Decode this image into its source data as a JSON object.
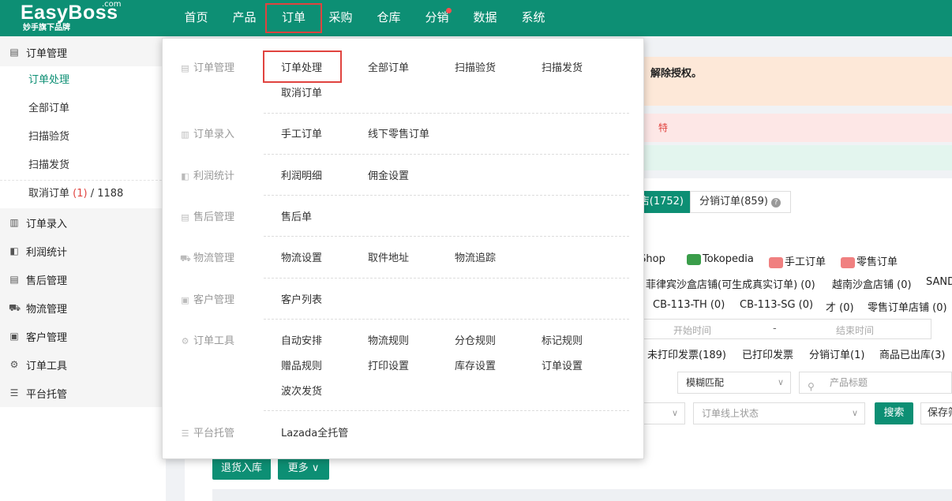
{
  "header": {
    "logo": "EasyBoss",
    "logo_com": ".com",
    "logo_sub": "妙手旗下品牌",
    "nav": [
      "首页",
      "产品",
      "订单",
      "采购",
      "仓库",
      "分销",
      "数据",
      "系统"
    ]
  },
  "sidebar": {
    "groups": [
      {
        "label": "订单管理",
        "icon": "order-doc-icon"
      },
      {
        "label": "订单录入",
        "icon": "order-entry-icon"
      },
      {
        "label": "利润统计",
        "icon": "profit-icon"
      },
      {
        "label": "售后管理",
        "icon": "aftersale-icon"
      },
      {
        "label": "物流管理",
        "icon": "truck-icon"
      },
      {
        "label": "客户管理",
        "icon": "customer-icon"
      },
      {
        "label": "订单工具",
        "icon": "tools-icon"
      },
      {
        "label": "平台托管",
        "icon": "hosting-icon"
      }
    ],
    "subitems": [
      "订单处理",
      "全部订单",
      "扫描验货",
      "扫描发货",
      "取消订单"
    ],
    "cancel_count": "(1)",
    "cancel_total": "/ 1188"
  },
  "main": {
    "alert1_text": "解除授权。",
    "alert2_text": "特",
    "tab_selected": "店(1752)",
    "tab_distribution": "分销订单(859)",
    "help_icon": "?",
    "platforms": [
      "&Shop",
      "Tokopedia",
      "手工订单",
      "零售订单"
    ],
    "shops_row1": [
      "菲律宾沙盒店铺(可生成真实订单) (0)",
      "越南沙盒店铺 (0)",
      "SAND"
    ],
    "shops_row2": [
      "CB-113-TH (0)",
      "CB-113-SG (0)",
      "才 (0)",
      "零售订单店铺 (0)"
    ],
    "date_start": "开始时间",
    "date_sep": "-",
    "date_end": "结束时间",
    "status_filters": [
      "未打印发票(189)",
      "已打印发票",
      "分销订单(1)",
      "商品已出库(3)"
    ],
    "match_select": "模糊匹配",
    "product_title_placeholder": "产品标题",
    "online_status_placeholder": "订单线上状态",
    "search_button": "搜索",
    "save_button": "保存筛",
    "return_button": "退货入库",
    "more_button": "更多"
  },
  "dropdown": {
    "rows": [
      {
        "category": "订单管理",
        "links": [
          "订单处理",
          "全部订单",
          "扫描验货",
          "扫描发货",
          "取消订单"
        ]
      },
      {
        "category": "订单录入",
        "links": [
          "手工订单",
          "线下零售订单"
        ]
      },
      {
        "category": "利润统计",
        "links": [
          "利润明细",
          "佣金设置"
        ]
      },
      {
        "category": "售后管理",
        "links": [
          "售后单"
        ]
      },
      {
        "category": "物流管理",
        "links": [
          "物流设置",
          "取件地址",
          "物流追踪"
        ]
      },
      {
        "category": "客户管理",
        "links": [
          "客户列表"
        ]
      },
      {
        "category": "订单工具",
        "links": [
          "自动安排",
          "物流规则",
          "分仓规则",
          "标记规则",
          "赠品规则",
          "打印设置",
          "库存设置",
          "订单设置",
          "波次发货"
        ]
      },
      {
        "category": "平台托管",
        "links": [
          "Lazada全托管"
        ]
      }
    ]
  },
  "colors": {
    "brand": "#0d8f74",
    "highlight": "#e0433f"
  }
}
